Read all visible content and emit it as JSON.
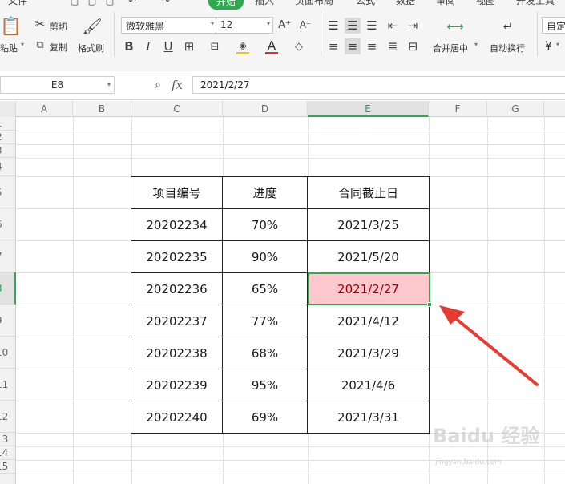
{
  "ribbon": {
    "tabs": [
      "文件",
      "开始",
      "插入",
      "页面布局",
      "公式",
      "数据",
      "审阅",
      "视图",
      "开发工具"
    ],
    "active_tab": "开始",
    "clipboard": {
      "paste": "粘贴",
      "cut": "剪切",
      "copy": "复制",
      "format_painter": "格式刷"
    },
    "font": {
      "name": "微软雅黑",
      "size": "12"
    },
    "align": {
      "merge_center": "合并居中",
      "wrap_text": "自动换行"
    },
    "number_format": "自定",
    "currency_symbol": "¥",
    "colors": {
      "font_color": "#e32b2b",
      "fill_color": "#f5c400",
      "accent": "#2fa84f"
    }
  },
  "formula_bar": {
    "cell_ref": "E8",
    "fx": "fx",
    "value": "2021/2/27"
  },
  "columns": [
    "A",
    "B",
    "C",
    "D",
    "E",
    "F",
    "G"
  ],
  "rows": [
    "1",
    "2",
    "3",
    "4",
    "5",
    "6",
    "7",
    "8",
    "9",
    "10",
    "11",
    "12",
    "13",
    "14",
    "15"
  ],
  "table": {
    "headers": [
      "项目编号",
      "进度",
      "合同截止日"
    ],
    "rows": [
      [
        "20202234",
        "70%",
        "2021/3/25"
      ],
      [
        "20202235",
        "90%",
        "2021/5/20"
      ],
      [
        "20202236",
        "65%",
        "2021/2/27"
      ],
      [
        "20202237",
        "77%",
        "2021/4/12"
      ],
      [
        "20202238",
        "68%",
        "2021/3/29"
      ],
      [
        "20202239",
        "95%",
        "2021/4/6"
      ],
      [
        "20202240",
        "69%",
        "2021/3/31"
      ]
    ]
  },
  "highlight": {
    "fill": "#ffc7ce",
    "text": "#9c0006"
  },
  "watermark": {
    "main": "Baidu 经验",
    "sub": "jingyan.baidu.com"
  },
  "arrow_color": "#e83a30"
}
